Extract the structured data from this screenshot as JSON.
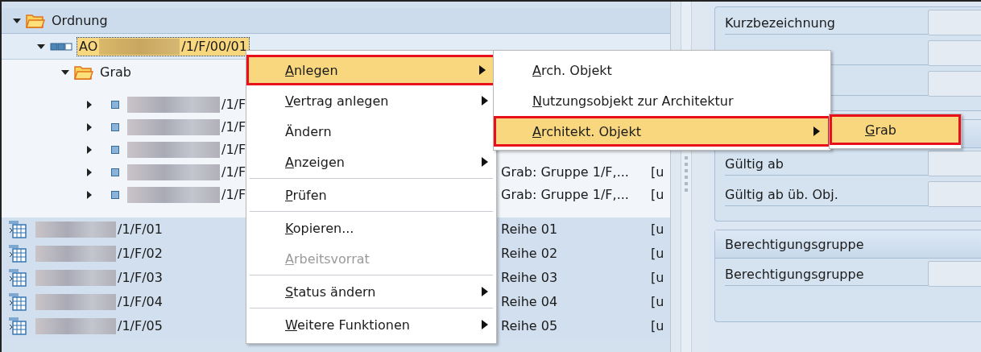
{
  "tree": {
    "rows": [
      {
        "kind": "folder",
        "label": "Ordnung",
        "expanded": true,
        "selected": false,
        "children": [
          {
            "kind": "object",
            "label": "AO",
            "redacted": true,
            "suffix": "/1/F/00/01",
            "expanded": true,
            "selected": true,
            "children": [
              {
                "kind": "folder",
                "label": "Grab",
                "expanded": true,
                "selected": false,
                "children": [
                  {
                    "kind": "item",
                    "redacted": true,
                    "suffix": "/1/F",
                    "expanded": false,
                    "selected": false
                  },
                  {
                    "kind": "item",
                    "redacted": true,
                    "suffix": "/1/F",
                    "expanded": false,
                    "selected": false
                  },
                  {
                    "kind": "item",
                    "redacted": true,
                    "suffix": "/1/F",
                    "expanded": false,
                    "selected": false
                  },
                  {
                    "kind": "item",
                    "redacted": true,
                    "suffix": "/1/F",
                    "expanded": false,
                    "selected": false,
                    "col2": "Grab: Gruppe 1/F,...",
                    "col3": "[u"
                  },
                  {
                    "kind": "item",
                    "redacted": true,
                    "suffix": "/1/F",
                    "expanded": false,
                    "selected": false,
                    "col2": "Grab: Gruppe 1/F,...",
                    "col3": "[u"
                  }
                ]
              }
            ]
          }
        ]
      },
      {
        "kind": "table",
        "redacted": true,
        "suffix": "/1/F/01",
        "selected": false,
        "col2": "Reihe 01",
        "col3": "[u"
      },
      {
        "kind": "table",
        "redacted": true,
        "suffix": "/1/F/02",
        "selected": false,
        "col2": "Reihe 02",
        "col3": "[u"
      },
      {
        "kind": "table",
        "redacted": true,
        "suffix": "/1/F/03",
        "selected": false,
        "col2": "Reihe 03",
        "col3": "[u"
      },
      {
        "kind": "table",
        "redacted": true,
        "suffix": "/1/F/04",
        "selected": false,
        "col2": "Reihe 04",
        "col3": "[u"
      },
      {
        "kind": "table",
        "redacted": true,
        "suffix": "/1/F/05",
        "selected": false,
        "col2": "Reihe 05",
        "col3": "[u"
      }
    ]
  },
  "detail": {
    "groups": [
      {
        "fields": [
          {
            "kind": "text",
            "label": "Kurzbezeichnung"
          },
          {
            "kind": "text"
          },
          {
            "kind": "text"
          }
        ]
      },
      {
        "fields": [
          {
            "kind": "text",
            "label": "Gültig ab"
          },
          {
            "kind": "text",
            "label": "Gültig ab üb. Obj."
          }
        ]
      },
      {
        "title": "Berechtigungsgruppe",
        "fields": [
          {
            "kind": "text",
            "label": "Berechtigungsgruppe"
          }
        ]
      }
    ]
  },
  "context_menu": {
    "items": [
      {
        "kind": "entry",
        "label": "Anlegen",
        "mnemonic": true,
        "submenu": true,
        "selected": true,
        "disabled": false
      },
      {
        "kind": "entry",
        "label": "Vertrag anlegen",
        "mnemonic": true,
        "submenu": true,
        "selected": false,
        "disabled": false
      },
      {
        "kind": "entry",
        "label": "Ändern",
        "mnemonic": false,
        "submenu": false,
        "selected": false,
        "disabled": false
      },
      {
        "kind": "entry",
        "label": "Anzeigen",
        "mnemonic": true,
        "submenu": true,
        "selected": false,
        "disabled": false
      },
      {
        "kind": "separator"
      },
      {
        "kind": "entry",
        "label": "Prüfen",
        "mnemonic": true,
        "submenu": false,
        "selected": false,
        "disabled": false
      },
      {
        "kind": "separator"
      },
      {
        "kind": "entry",
        "label": "Kopieren...",
        "mnemonic": true,
        "submenu": false,
        "selected": false,
        "disabled": false
      },
      {
        "kind": "entry",
        "label": "Arbeitsvorrat",
        "mnemonic": true,
        "submenu": false,
        "selected": false,
        "disabled": true
      },
      {
        "kind": "separator"
      },
      {
        "kind": "entry",
        "label": "Status ändern",
        "mnemonic": true,
        "submenu": true,
        "selected": false,
        "disabled": false
      },
      {
        "kind": "separator"
      },
      {
        "kind": "entry",
        "label": "Weitere Funktionen",
        "mnemonic": true,
        "submenu": true,
        "selected": false,
        "disabled": false
      }
    ]
  },
  "submenu": {
    "items": [
      {
        "kind": "entry",
        "label": "Arch. Objekt",
        "mnemonic": true,
        "submenu": false,
        "selected": false,
        "disabled": false
      },
      {
        "kind": "entry",
        "label": "Nutzungsobjekt zur Architektur",
        "mnemonic": true,
        "submenu": false,
        "selected": false,
        "disabled": false
      },
      {
        "kind": "entry",
        "label": "Architekt. Objekt",
        "mnemonic": true,
        "submenu": true,
        "selected": true,
        "disabled": false
      }
    ]
  },
  "submenu_2": {
    "items": [
      {
        "kind": "entry",
        "label": "Grab",
        "mnemonic": true,
        "submenu": false,
        "selected": true,
        "disabled": false
      }
    ]
  }
}
